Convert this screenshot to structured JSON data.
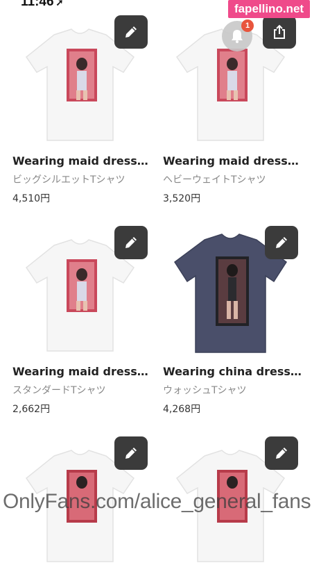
{
  "status_bar": {
    "time": "11:46",
    "location_glyph": "➚"
  },
  "watermark": {
    "site": "fapellino.net",
    "footer": "OnlyFans.com/alice_general_fans"
  },
  "notification": {
    "badge_count": "1",
    "icon": "bell-icon"
  },
  "share": {
    "icon": "share-icon"
  },
  "colors": {
    "button_bg": "#3b3b3b",
    "badge": "#e8553d",
    "watermark_tag": "#ef4a8a",
    "shirt_white": "#f4f4f4",
    "shirt_wash": "#4a4f6a"
  },
  "products": [
    {
      "title": "Wearing maid dress…",
      "type": "ビッグシルエットTシャツ",
      "price": "4,510円",
      "shirt_color": "white"
    },
    {
      "title": "Wearing maid dress…",
      "type": "ヘビーウェイトTシャツ",
      "price": "3,520円",
      "shirt_color": "white"
    },
    {
      "title": "Wearing maid dress…",
      "type": "スタンダードTシャツ",
      "price": "2,662円",
      "shirt_color": "white"
    },
    {
      "title": "Wearing china dress…",
      "type": "ウォッシュTシャツ",
      "price": "4,268円",
      "shirt_color": "wash"
    },
    {
      "title": "",
      "type": "",
      "price": "",
      "shirt_color": "white"
    },
    {
      "title": "",
      "type": "",
      "price": "",
      "shirt_color": "white"
    }
  ]
}
